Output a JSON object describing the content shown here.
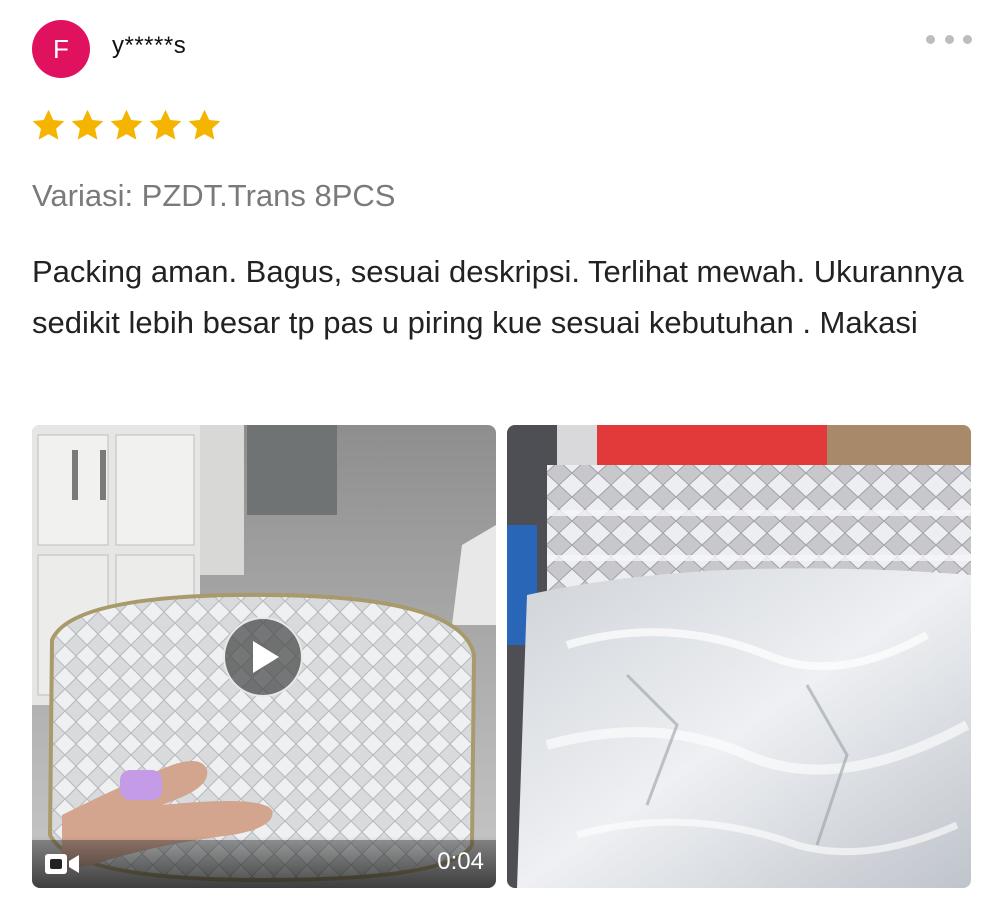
{
  "reviewer": {
    "avatar_initial": "F",
    "avatar_color": "#e0115f",
    "username": "y*****s"
  },
  "menu": {
    "icon": "more-dots-icon"
  },
  "rating": {
    "stars": 5,
    "max": 5,
    "star_color": "#f5b400"
  },
  "variation": "Variasi: PZDT.Trans 8PCS",
  "review_text": "Packing aman. Bagus, sesuai deskripsi. Terlihat mewah. Ukurannya sedikit lebih besar tp pas u piring kue sesuai kebutuhan . Makasi",
  "media": [
    {
      "type": "video",
      "duration": "0:04",
      "icons": [
        "play-icon",
        "video-camera-icon"
      ]
    },
    {
      "type": "photo"
    }
  ]
}
